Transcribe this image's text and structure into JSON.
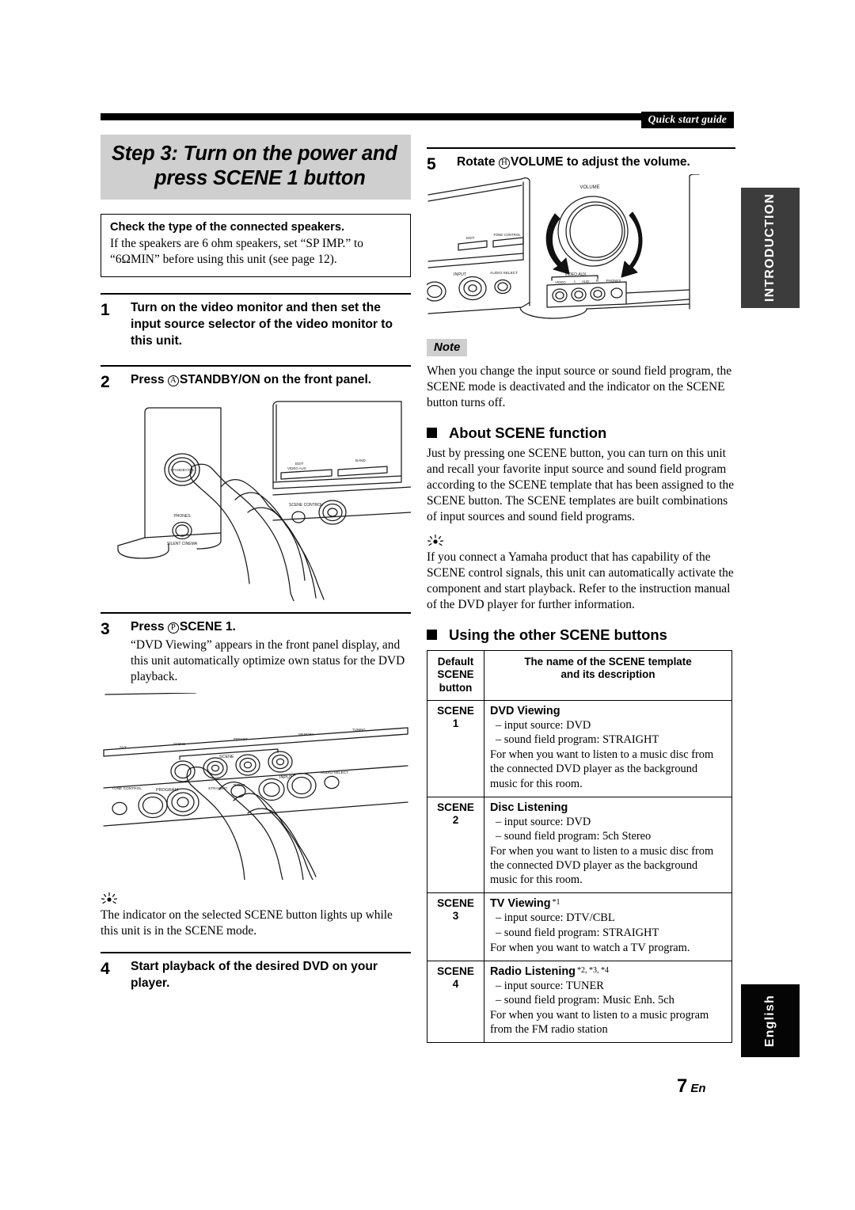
{
  "header": {
    "tag": "Quick start guide"
  },
  "side_tabs": {
    "introduction": "INTRODUCTION",
    "language": "English"
  },
  "footer": {
    "page_number": "7",
    "page_suffix": "En"
  },
  "banner": {
    "line1": "Step 3: Turn on the power and",
    "line2": "press SCENE 1 button"
  },
  "notice": {
    "title": "Check the type of the connected speakers.",
    "body": "If the speakers are 6 ohm speakers, set “SP IMP.” to “6ΩMIN” before using this unit (see page 12)."
  },
  "steps": {
    "s1": {
      "num": "1",
      "head": "Turn on the video monitor and then set the input source selector of the video monitor to this unit."
    },
    "s2": {
      "num": "2",
      "head_pre": "Press ",
      "circle": "A",
      "head_bold": "STANDBY/ON",
      "head_post": " on the front panel."
    },
    "s3": {
      "num": "3",
      "head_pre": "Press ",
      "circle": "P",
      "head_bold": "SCENE 1.",
      "body": "“DVD Viewing” appears in the front panel display, and this unit automatically optimize own status for the DVD playback."
    },
    "s3_tip": {
      "glyph": "☀",
      "body": "The indicator on the selected SCENE button lights up while this unit is in the SCENE mode."
    },
    "s4": {
      "num": "4",
      "head": "Start playback of the desired DVD on your player."
    },
    "s5": {
      "num": "5",
      "head_pre": "Rotate ",
      "circle": "H",
      "head_bold": "VOLUME",
      "head_post": " to adjust the volume."
    }
  },
  "note": {
    "badge": "Note",
    "body": "When you change the input source or sound field program, the SCENE mode is deactivated and the indicator on the SCENE button turns off."
  },
  "about_scene": {
    "heading": "About SCENE function",
    "para": "Just by pressing one SCENE button, you can turn on this unit and recall your favorite input source and sound field program according to the SCENE template that has been assigned to the SCENE button. The SCENE templates are built combinations of input sources and sound field programs.",
    "tip_glyph": "☀",
    "tip": "If you connect a Yamaha product that has capability of the SCENE control signals, this unit can automatically activate the component and start playback. Refer to the instruction manual of the DVD player for further information."
  },
  "other_scene": {
    "heading": "Using the other SCENE buttons",
    "table": {
      "headers": {
        "col1_l1": "Default",
        "col1_l2": "SCENE",
        "col1_l3": "button",
        "col2_l1": "The name of the SCENE template",
        "col2_l2": "and its description"
      },
      "rows": [
        {
          "button_l1": "SCENE",
          "button_l2": "1",
          "name": "DVD Viewing",
          "footnotes": "",
          "bullets": [
            "– input source: DVD",
            "– sound field program: STRAIGHT"
          ],
          "desc": "For when you want to listen to a music disc from the connected DVD player as the background music for this room."
        },
        {
          "button_l1": "SCENE",
          "button_l2": "2",
          "name": "Disc Listening",
          "footnotes": "",
          "bullets": [
            "– input source: DVD",
            "– sound field program: 5ch Stereo"
          ],
          "desc": "For when you want to listen to a music disc from the connected DVD player as the background music for this room."
        },
        {
          "button_l1": "SCENE",
          "button_l2": "3",
          "name": "TV Viewing",
          "footnotes": "*1",
          "bullets": [
            "– input source: DTV/CBL",
            "– sound field program: STRAIGHT"
          ],
          "desc": "For when you want to watch a TV program."
        },
        {
          "button_l1": "SCENE",
          "button_l2": "4",
          "name": "Radio Listening",
          "footnotes": "*2, *3, *4",
          "bullets": [
            "– input source: TUNER",
            "– sound field program: Music Enh. 5ch"
          ],
          "desc": "For when you want to listen to a music program from the FM radio station"
        }
      ]
    }
  },
  "figures": {
    "standby": {
      "labels": {
        "standby": "STANDBY/ON",
        "phones": "PHONES",
        "silent": "SILENT CINEMA",
        "edit": "EDIT",
        "video_aux": "VIDEO AUX",
        "band": "BAND",
        "scene_control": "SCENE CONTROL"
      }
    },
    "scene_press": {
      "labels": {
        "scene": "SCENE",
        "program": "PROGRAM",
        "straight": "STRAIGHT",
        "input": "INPUT",
        "audio_select": "AUDIO SELECT",
        "tone_control": "TONE CONTROL",
        "preset": "PRESET",
        "memory": "MEMORY",
        "tuning": "TUNING"
      }
    },
    "volume": {
      "labels": {
        "volume": "VOLUME",
        "video_aux": "VIDEO AUX",
        "video": "VIDEO",
        "l": "L",
        "aud": "AUD",
        "r": "R",
        "phones": "PHONES",
        "input": "INPUT",
        "audio_select": "AUDIO SELECT",
        "edit": "EDIT",
        "tone_control": "TONE CONTROL"
      }
    }
  }
}
